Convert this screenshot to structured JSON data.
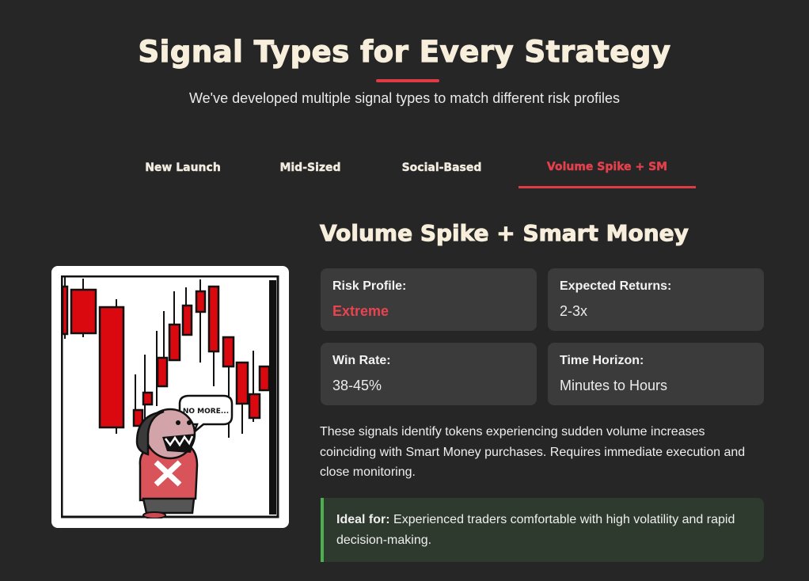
{
  "header": {
    "title": "Signal Types for Every Strategy",
    "subtitle": "We've developed multiple signal types to match different risk profiles"
  },
  "tabs": [
    {
      "label": "New Launch",
      "active": false
    },
    {
      "label": "Mid-Sized",
      "active": false
    },
    {
      "label": "Social-Based",
      "active": false
    },
    {
      "label": "Volume Spike + SM",
      "active": true
    }
  ],
  "detail": {
    "title": "Volume Spike + Smart Money",
    "stats": [
      {
        "label": "Risk Profile:",
        "value": "Extreme"
      },
      {
        "label": "Expected Returns:",
        "value": "2-3x"
      },
      {
        "label": "Win Rate:",
        "value": "38-45%"
      },
      {
        "label": "Time Horizon:",
        "value": "Minutes to Hours"
      }
    ],
    "description": "These signals identify tokens experiencing sudden volume increases coinciding with Smart Money purchases. Requires immediate execution and close monitoring.",
    "ideal_label": "Ideal for:",
    "ideal_text": "Experienced traders comfortable with high volatility and rapid decision-making."
  },
  "illustration": {
    "speech_bubble": "NO MORE..."
  },
  "colors": {
    "accent_red": "#e03a45",
    "ideal_border": "#4caf50",
    "background": "#262626",
    "card": "#3b3b3b"
  }
}
